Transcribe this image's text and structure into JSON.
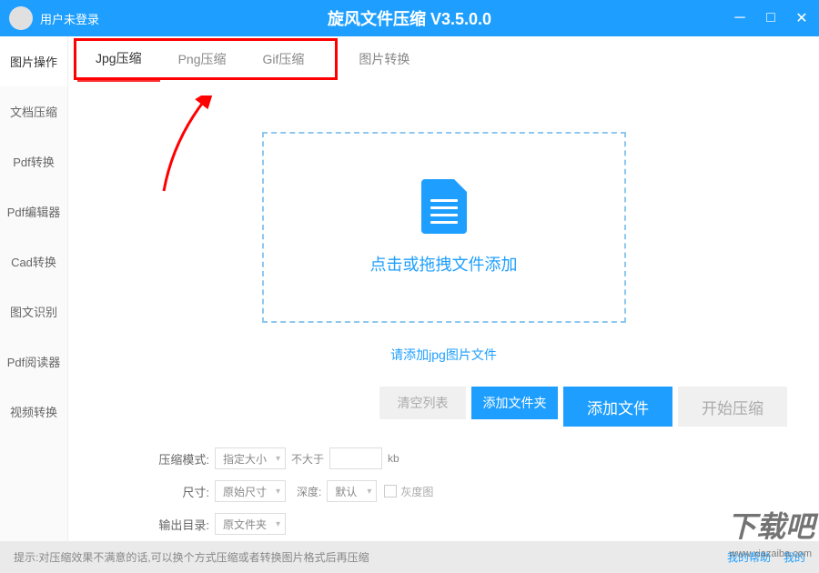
{
  "header": {
    "login_status": "用户未登录",
    "title": "旋风文件压缩 V3.5.0.0"
  },
  "sidebar": {
    "items": [
      {
        "label": "图片操作"
      },
      {
        "label": "文档压缩"
      },
      {
        "label": "Pdf转换"
      },
      {
        "label": "Pdf编辑器"
      },
      {
        "label": "Cad转换"
      },
      {
        "label": "图文识别"
      },
      {
        "label": "Pdf阅读器"
      },
      {
        "label": "视频转换"
      }
    ]
  },
  "tabs": [
    {
      "label": "Jpg压缩"
    },
    {
      "label": "Png压缩"
    },
    {
      "label": "Gif压缩"
    },
    {
      "label": "图片转换"
    }
  ],
  "dropzone": {
    "text": "点击或拖拽文件添加"
  },
  "help_text": "请添加jpg图片文件",
  "actions": {
    "clear": "清空列表",
    "add_folder": "添加文件夹",
    "add_file": "添加文件",
    "start": "开始压缩"
  },
  "settings": {
    "mode_label": "压缩模式:",
    "mode_value": "指定大小",
    "le_label": "不大于",
    "size_unit": "kb",
    "size_label": "尺寸:",
    "size_value": "原始尺寸",
    "depth_label": "深度:",
    "depth_value": "默认",
    "grayscale": "灰度图",
    "output_label": "输出目录:",
    "output_value": "原文件夹"
  },
  "footer": {
    "tip": "提示:对压缩效果不满意的话,可以换个方式压缩或者转换图片格式后再压缩",
    "help_link": "我的帮助",
    "my_link": "我的"
  },
  "watermark": {
    "text": "下载吧",
    "url": "www.xiazaiba.com"
  }
}
